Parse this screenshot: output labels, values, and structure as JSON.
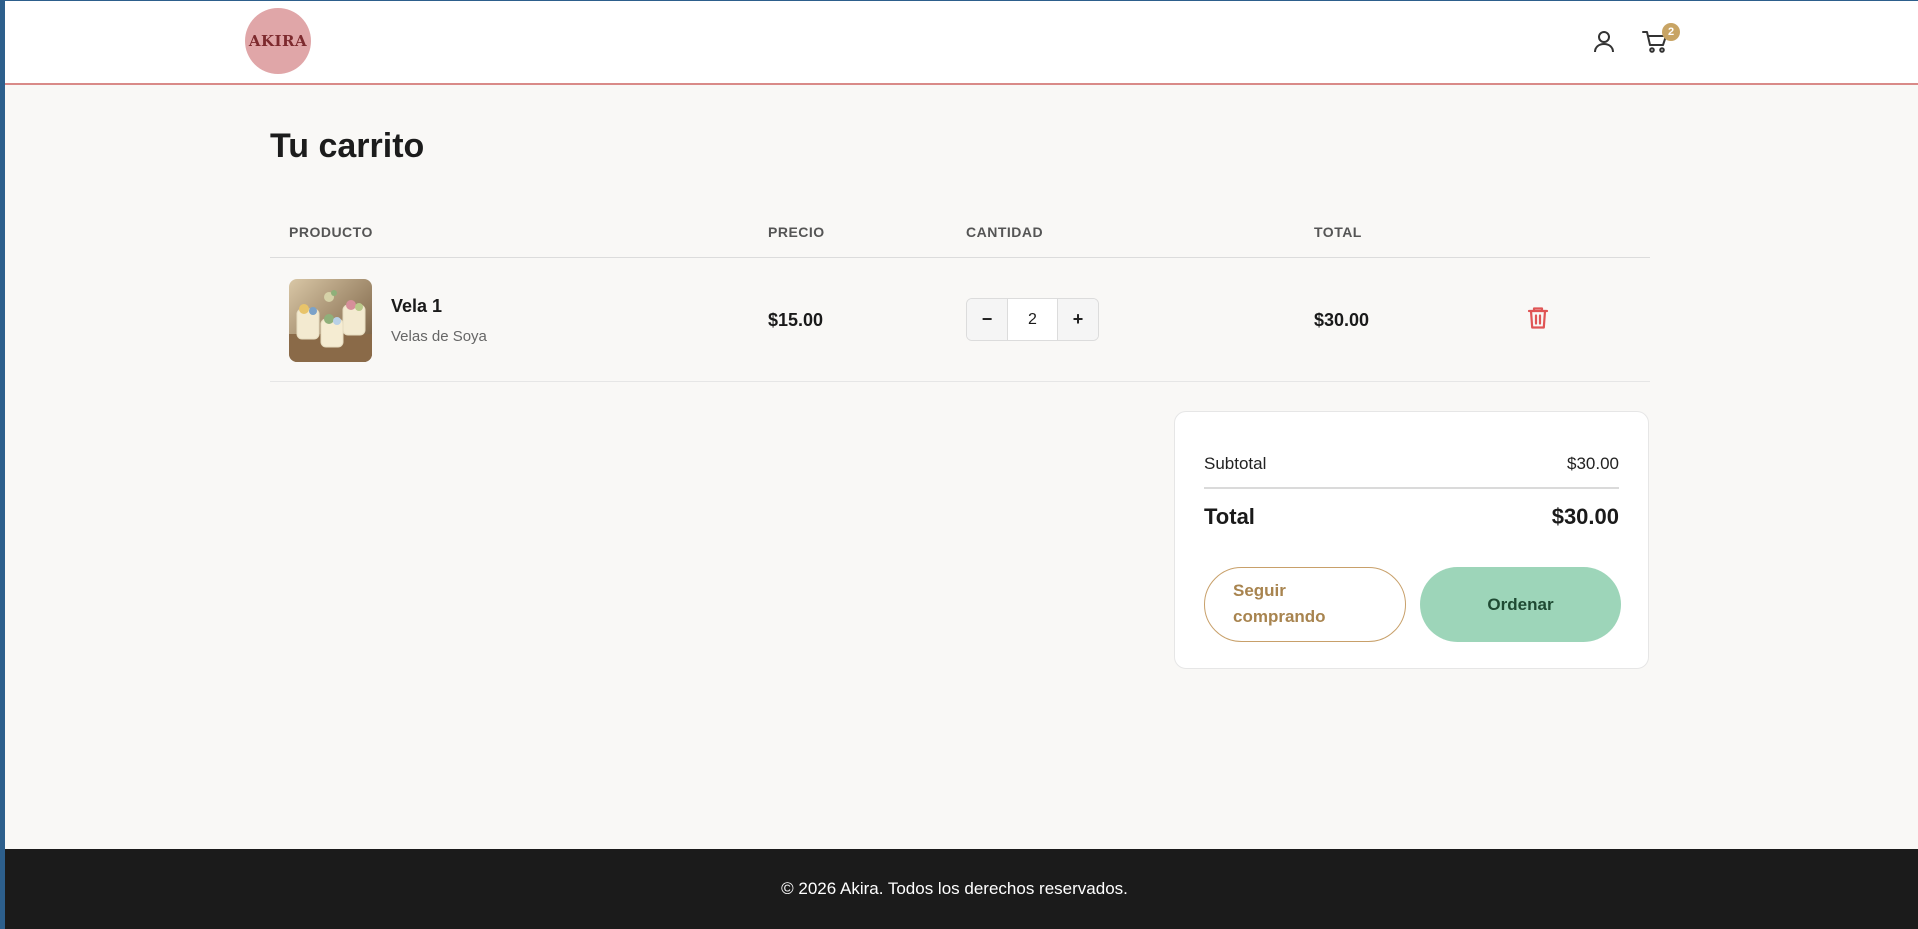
{
  "header": {
    "logo_text": "AKIRA",
    "user_icon": "user-icon",
    "cart_icon": "cart-icon",
    "cart_count": "2"
  },
  "page": {
    "title": "Tu carrito"
  },
  "table": {
    "columns": [
      "PRODUCTO",
      "PRECIO",
      "CANTIDAD",
      "TOTAL"
    ],
    "rows": [
      {
        "name": "Vela 1",
        "category": "Velas de Soya",
        "price": "$15.00",
        "quantity": "2",
        "total": "$30.00",
        "decrement_label": "−",
        "increment_label": "+",
        "delete_icon": "trash-icon"
      }
    ]
  },
  "summary": {
    "subtotal_label": "Subtotal",
    "subtotal_value": "$30.00",
    "total_label": "Total",
    "total_value": "$30.00",
    "continue_label": "Seguir comprando",
    "order_label": "Ordenar"
  },
  "footer": {
    "text": "© 2026 Akira. Todos los derechos reservados."
  },
  "colors": {
    "accent_gold": "#c8a464",
    "order_green": "#9dd5b9",
    "delete_red": "#e05555",
    "header_border": "#d98a88",
    "logo_bg": "#e0a6a8",
    "footer_bg": "#1b1b1b"
  }
}
